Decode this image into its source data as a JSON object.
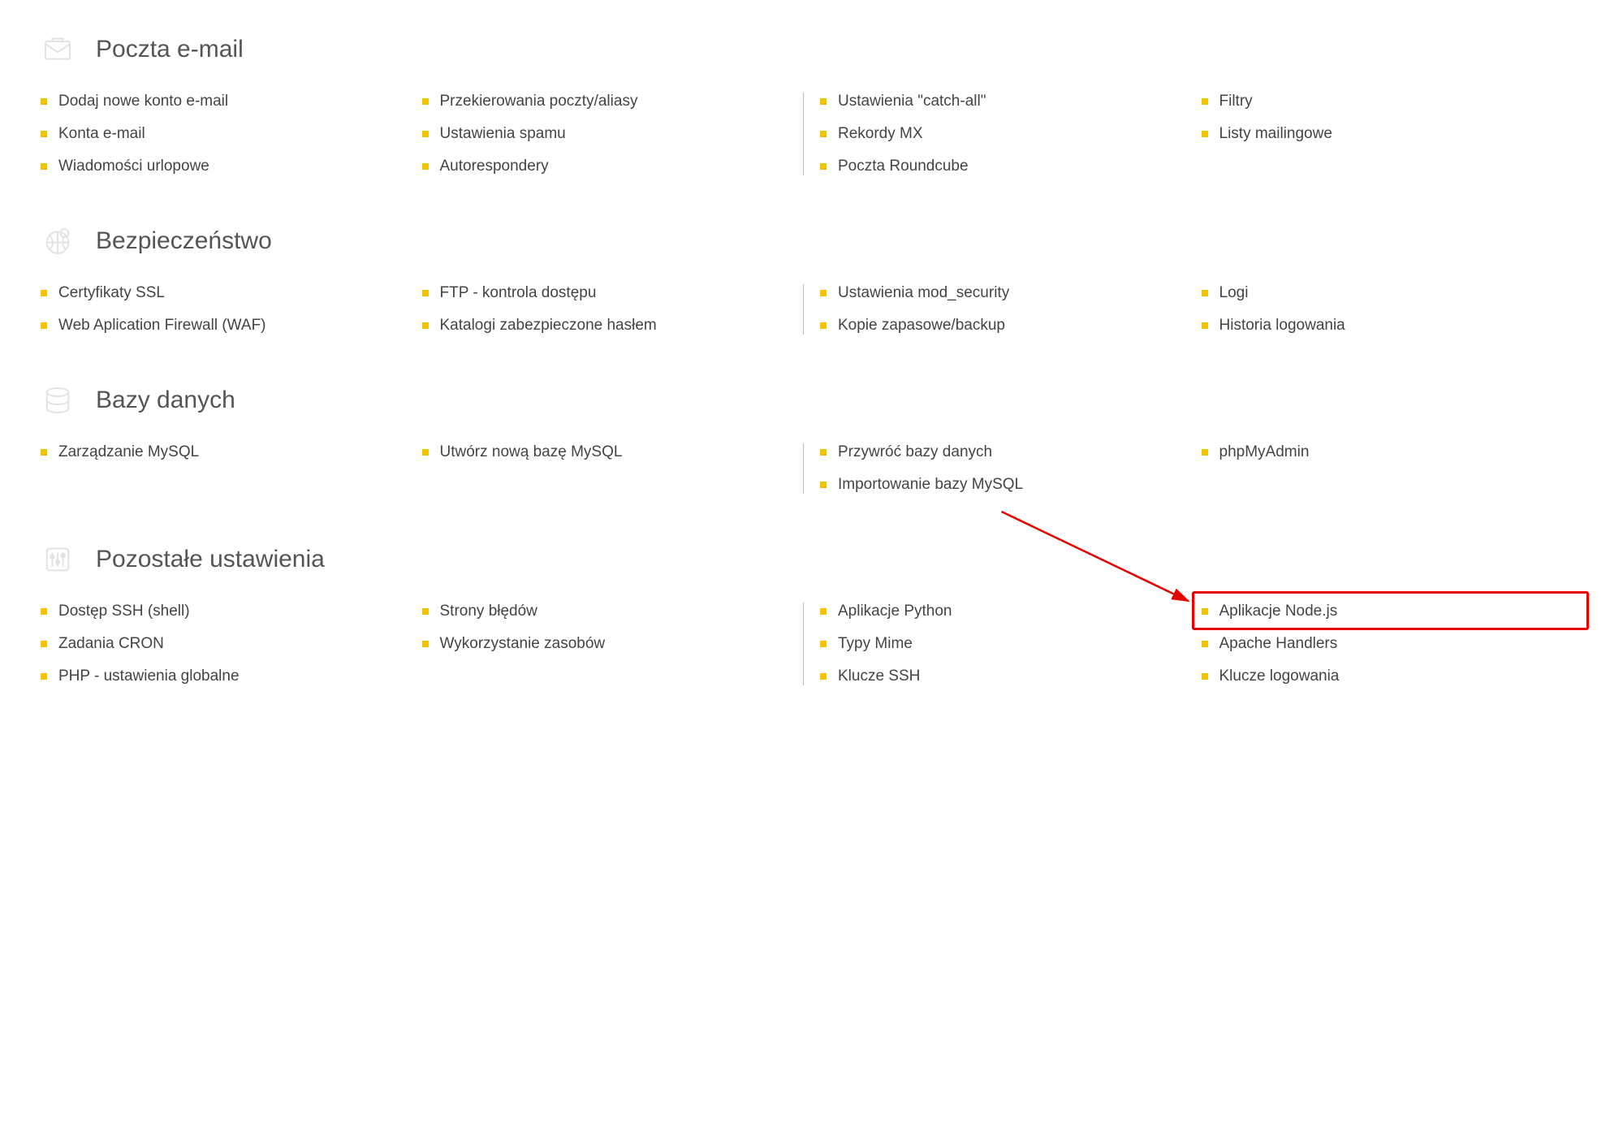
{
  "sections": [
    {
      "id": "email",
      "title": "Poczta e-mail",
      "icon": "mail-icon",
      "columns": [
        [
          "Dodaj nowe konto e-mail",
          "Konta e-mail",
          "Wiadomości urlopowe"
        ],
        [
          "Przekierowania poczty/aliasy",
          "Ustawienia spamu",
          "Autorespondery"
        ],
        [
          "Ustawienia \"catch-all\"",
          "Rekordy MX",
          "Poczta Roundcube"
        ],
        [
          "Filtry",
          "Listy mailingowe"
        ]
      ]
    },
    {
      "id": "security",
      "title": "Bezpieczeństwo",
      "icon": "shield-icon",
      "columns": [
        [
          "Certyfikaty SSL",
          "Web Aplication Firewall (WAF)"
        ],
        [
          "FTP - kontrola dostępu",
          "Katalogi zabezpieczone hasłem"
        ],
        [
          "Ustawienia mod_security",
          "Kopie zapasowe/backup"
        ],
        [
          "Logi",
          "Historia logowania"
        ]
      ]
    },
    {
      "id": "databases",
      "title": "Bazy danych",
      "icon": "database-icon",
      "columns": [
        [
          "Zarządzanie MySQL"
        ],
        [
          "Utwórz nową bazę MySQL"
        ],
        [
          "Przywróć bazy danych",
          "Importowanie bazy MySQL"
        ],
        [
          "phpMyAdmin"
        ]
      ]
    },
    {
      "id": "other",
      "title": "Pozostałe ustawienia",
      "icon": "settings-icon",
      "columns": [
        [
          "Dostęp SSH (shell)",
          "Zadania CRON",
          "PHP - ustawienia globalne"
        ],
        [
          "Strony błędów",
          "Wykorzystanie zasobów"
        ],
        [
          "Aplikacje Python",
          "Typy Mime",
          "Klucze SSH"
        ],
        [
          "Aplikacje Node.js",
          "Apache Handlers",
          "Klucze logowania"
        ]
      ]
    }
  ],
  "highlight": {
    "section": "other",
    "column": 3,
    "item": 0
  }
}
